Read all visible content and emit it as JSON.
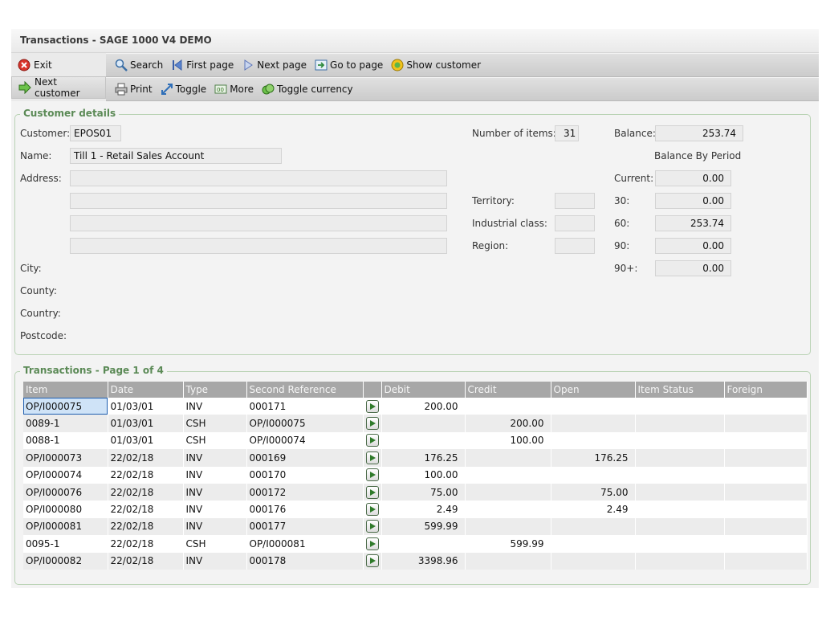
{
  "window": {
    "title": "Transactions - SAGE 1000 V4 DEMO"
  },
  "leftbar": {
    "exit_label": "Exit",
    "next_customer_label": "Next customer"
  },
  "toolbar1": {
    "search": "Search",
    "first_page": "First page",
    "next_page": "Next page",
    "go_to_page": "Go to page",
    "show_customer": "Show customer"
  },
  "toolbar2": {
    "print": "Print",
    "toggle": "Toggle",
    "more": "More",
    "toggle_currency": "Toggle currency"
  },
  "customer": {
    "section_title": "Customer details",
    "labels": {
      "customer": "Customer:",
      "name": "Name:",
      "address": "Address:",
      "city": "City:",
      "county": "County:",
      "country": "Country:",
      "postcode": "Postcode:",
      "number_of_items": "Number of items:",
      "territory": "Territory:",
      "industrial_class": "Industrial class:",
      "region": "Region:",
      "balance": "Balance:",
      "balance_by_period": "Balance By Period",
      "current": "Current:",
      "p30": "30:",
      "p60": "60:",
      "p90": "90:",
      "p90plus": "90+:"
    },
    "values": {
      "customer": "EPOS01",
      "name": "Till 1 - Retail Sales Account",
      "address1": "",
      "address2": "",
      "address3": "",
      "address4": "",
      "number_of_items": "31",
      "territory": "",
      "industrial_class": "",
      "region": "",
      "balance": "253.74",
      "current": "0.00",
      "p30": "0.00",
      "p60": "253.74",
      "p90": "0.00",
      "p90plus": "0.00"
    }
  },
  "transactions": {
    "section_title": "Transactions - Page 1 of 4",
    "columns": [
      "Item",
      "Date",
      "Type",
      "Second Reference",
      "",
      "Debit",
      "Credit",
      "Open",
      "Item Status",
      "Foreign"
    ],
    "rows": [
      {
        "item": "OP/I000075",
        "date": "01/03/01",
        "type": "INV",
        "ref": "000171",
        "debit": "200.00",
        "credit": "",
        "open": "",
        "status": "",
        "foreign": ""
      },
      {
        "item": "0089-1",
        "date": "01/03/01",
        "type": "CSH",
        "ref": "OP/I000075",
        "debit": "",
        "credit": "200.00",
        "open": "",
        "status": "",
        "foreign": ""
      },
      {
        "item": "0088-1",
        "date": "01/03/01",
        "type": "CSH",
        "ref": "OP/I000074",
        "debit": "",
        "credit": "100.00",
        "open": "",
        "status": "",
        "foreign": ""
      },
      {
        "item": "OP/I000073",
        "date": "22/02/18",
        "type": "INV",
        "ref": "000169",
        "debit": "176.25",
        "credit": "",
        "open": "176.25",
        "status": "",
        "foreign": ""
      },
      {
        "item": "OP/I000074",
        "date": "22/02/18",
        "type": "INV",
        "ref": "000170",
        "debit": "100.00",
        "credit": "",
        "open": "",
        "status": "",
        "foreign": ""
      },
      {
        "item": "OP/I000076",
        "date": "22/02/18",
        "type": "INV",
        "ref": "000172",
        "debit": "75.00",
        "credit": "",
        "open": "75.00",
        "status": "",
        "foreign": ""
      },
      {
        "item": "OP/I000080",
        "date": "22/02/18",
        "type": "INV",
        "ref": "000176",
        "debit": "2.49",
        "credit": "",
        "open": "2.49",
        "status": "",
        "foreign": ""
      },
      {
        "item": "OP/I000081",
        "date": "22/02/18",
        "type": "INV",
        "ref": "000177",
        "debit": "599.99",
        "credit": "",
        "open": "",
        "status": "",
        "foreign": ""
      },
      {
        "item": "0095-1",
        "date": "22/02/18",
        "type": "CSH",
        "ref": "OP/I000081",
        "debit": "",
        "credit": "599.99",
        "open": "",
        "status": "",
        "foreign": ""
      },
      {
        "item": "OP/I000082",
        "date": "22/02/18",
        "type": "INV",
        "ref": "000178",
        "debit": "3398.96",
        "credit": "",
        "open": "",
        "status": "",
        "foreign": ""
      }
    ]
  },
  "colors": {
    "accent_green": "#5b8a56",
    "header_grey": "#a7a7a7",
    "selection_blue": "#1f5fb0"
  },
  "icons": {
    "exit": "exit-icon",
    "next_customer": "arrow-right-icon",
    "search": "search-icon",
    "first_page": "first-page-icon",
    "next_page": "next-page-icon",
    "go_to_page": "go-to-page-icon",
    "show_customer": "show-customer-icon",
    "print": "printer-icon",
    "toggle": "toggle-icon",
    "more": "more-icon",
    "toggle_currency": "currency-icon",
    "row_action": "play-icon"
  }
}
